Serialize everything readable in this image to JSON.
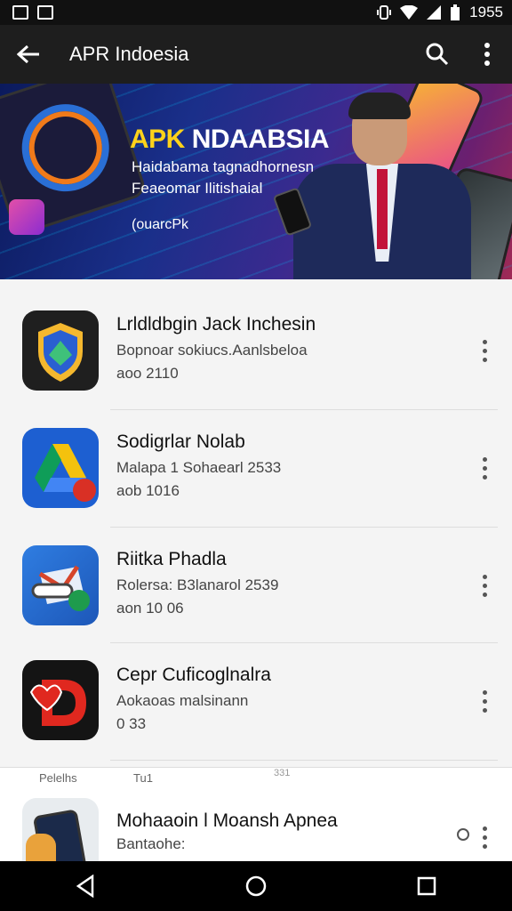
{
  "status_bar": {
    "time": "1955"
  },
  "app_bar": {
    "title": "APR Indoesia",
    "back_icon": "arrow-left-icon",
    "search_icon": "search-icon",
    "more_icon": "more-vertical-icon"
  },
  "banner": {
    "title_part1": "APK",
    "title_part2": "NDAABSIA",
    "subtitle1": "Haidabama tagnadhornesn",
    "subtitle2": "Feaeomar Ilitishaial",
    "tag": "(ouarcPk"
  },
  "apps": [
    {
      "name": "Lrldldbgin Jack Inchesin",
      "developer": "Bopnoar sokiucs.Aanlsbeloa",
      "size": "aoo 2110",
      "icon": "shield-app-icon"
    },
    {
      "name": "Sodigrlar Nolab",
      "developer": "Malapa 1 Sohaearl 2533",
      "size": "aob 1016",
      "icon": "drive-app-icon"
    },
    {
      "name": "Riitka Phadla",
      "developer": "Rolersa: B3lanarol 2539",
      "size": "aon 10 06",
      "icon": "mail-app-icon"
    },
    {
      "name": "Cepr Cuficoglnalra",
      "developer": "Aokaoas malsinann",
      "size": "0 33",
      "icon": "red-d-app-icon"
    }
  ],
  "bottom_sheet": {
    "tab1": "Pelelhs",
    "tab2": "Tu1",
    "tab3": "331",
    "name": "Mohaaoin l Moansh Apnea",
    "sub": "Bantaohe:",
    "icon": "phone-app-icon"
  },
  "nav": {
    "back": "back-triangle-icon",
    "home": "home-circle-icon",
    "recents": "recents-square-icon"
  },
  "colors": {
    "app_bar": "#1e1e1e",
    "status_bar": "#111111",
    "banner_title": "#ffd21a",
    "background": "#f4f4f4"
  }
}
